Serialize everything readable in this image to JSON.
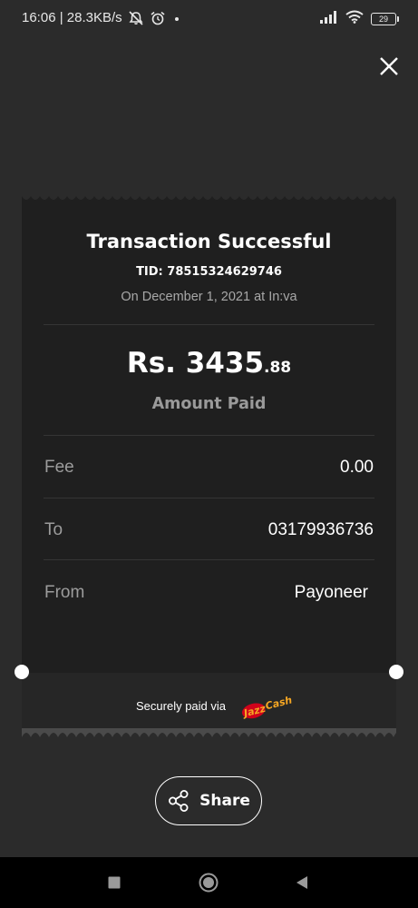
{
  "status_bar": {
    "time_speed": "16:06 | 28.3KB/s",
    "battery": "29",
    "icons": [
      "mute-icon",
      "alarm-icon",
      "dot-icon",
      "signal-icon",
      "wifi-icon",
      "battery-icon"
    ]
  },
  "receipt": {
    "title": "Transaction Successful",
    "tid": "TID: 78515324629746",
    "date": "On December 1, 2021 at In:va",
    "amount_main": "Rs. 3435",
    "amount_decimal": ".88",
    "amount_label": "Amount Paid",
    "rows": [
      {
        "label": "Fee",
        "value": "0.00"
      },
      {
        "label": "To",
        "value": "03179936736"
      },
      {
        "label": "From",
        "value": "Payoneer"
      }
    ],
    "footer_text": "Securely paid via",
    "logo_text": "JazzCash"
  },
  "share": {
    "label": "Share"
  },
  "colors": {
    "background": "#2b2b2b",
    "receipt": "#1f1f1f",
    "logo_yellow": "#f5a623",
    "logo_red": "#d0021b"
  }
}
